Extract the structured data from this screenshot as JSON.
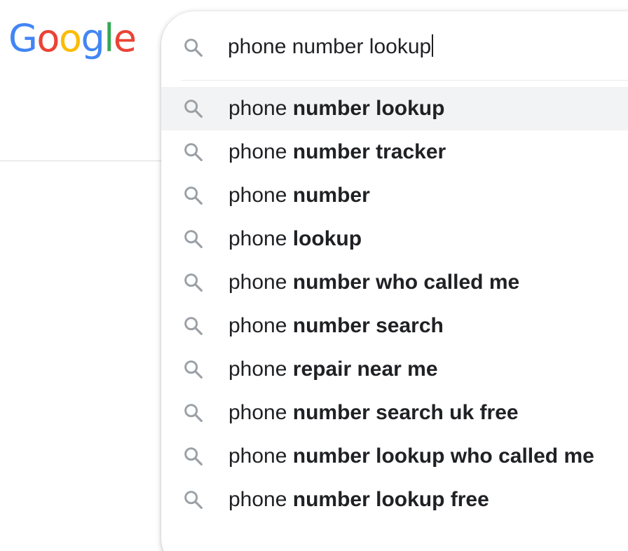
{
  "logo": {
    "letters": [
      {
        "ch": "G",
        "color": "#4285F4"
      },
      {
        "ch": "o",
        "color": "#EA4335"
      },
      {
        "ch": "o",
        "color": "#FBBC05"
      },
      {
        "ch": "g",
        "color": "#4285F4"
      },
      {
        "ch": "l",
        "color": "#34A853"
      },
      {
        "ch": "e",
        "color": "#EA4335"
      }
    ]
  },
  "search": {
    "value": "phone number lookup",
    "icon": "search-icon"
  },
  "suggestions": [
    {
      "prefix": "phone ",
      "completion": "number lookup",
      "highlighted": true
    },
    {
      "prefix": "phone ",
      "completion": "number tracker",
      "highlighted": false
    },
    {
      "prefix": "phone ",
      "completion": "number",
      "highlighted": false
    },
    {
      "prefix": "phone ",
      "completion": "lookup",
      "highlighted": false
    },
    {
      "prefix": "phone ",
      "completion": "number who called me",
      "highlighted": false
    },
    {
      "prefix": "phone ",
      "completion": "number search",
      "highlighted": false
    },
    {
      "prefix": "phone ",
      "completion": "repair near me",
      "highlighted": false
    },
    {
      "prefix": "phone ",
      "completion": "number search uk free",
      "highlighted": false
    },
    {
      "prefix": "phone ",
      "completion": "number lookup who called me",
      "highlighted": false
    },
    {
      "prefix": "phone ",
      "completion": "number lookup free",
      "highlighted": false
    }
  ],
  "colors": {
    "text": "#202124",
    "icon": "#9aa0a6",
    "highlight": "#f1f3f4",
    "divider": "#dadce0"
  }
}
